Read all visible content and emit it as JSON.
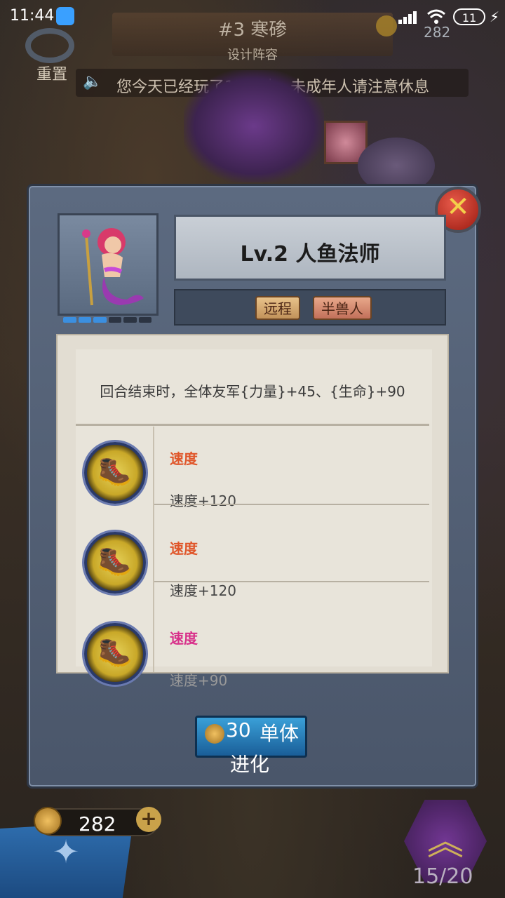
{
  "status_bar": {
    "time": "11:44",
    "battery": "11"
  },
  "header": {
    "stage_title": "#3 寒碜",
    "stage_subtitle": "设计阵容",
    "reset_label": "重置",
    "gold": "282",
    "notice": "您今天已经玩了15分钟，未成年人请注意休息"
  },
  "hero": {
    "name": "Lv.2 人鱼法师",
    "tags": [
      "远程",
      "半兽人"
    ],
    "star_segments_total": 6,
    "star_segments_filled": 3,
    "description": "回合结束时，全体友军{力量}+45、{生命}+90"
  },
  "skills": [
    {
      "name": "速度",
      "value": "速度+120",
      "name_color": "#e0562a",
      "icon": "boot-icon"
    },
    {
      "name": "速度",
      "value": "速度+120",
      "name_color": "#e0562a",
      "icon": "boot-icon"
    },
    {
      "name": "速度",
      "value": "速度+90",
      "name_color": "#d8308a",
      "icon": "boot-icon"
    }
  ],
  "evolve": {
    "cost": "30",
    "label": "单体",
    "label2": "进化"
  },
  "footer": {
    "gold": "282",
    "upgrade_count": "15/20"
  },
  "colors": {
    "panel": "#56647a",
    "accent_blue": "#2a86c8",
    "close_red": "#c83a2a"
  }
}
